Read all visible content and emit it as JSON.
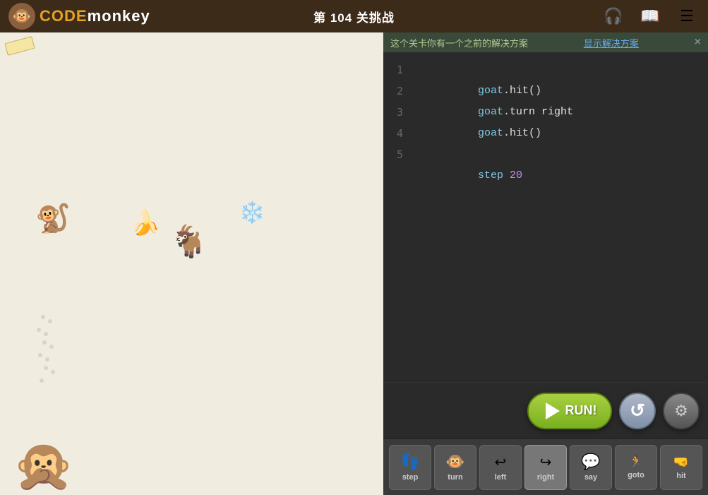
{
  "header": {
    "logo_monkey_emoji": "🐵",
    "logo_text_code": "CODE",
    "logo_text_monkey": "monkey",
    "title": "第 104 关挑战",
    "icon_headphones": "🎧",
    "icon_map": "📖",
    "icon_menu": "☰"
  },
  "notice": {
    "text": "这个关卡你有一个之前的解决方案",
    "link_text": "显示解决方案",
    "close": "×"
  },
  "code": {
    "lines": [
      {
        "num": "1",
        "content": "goat.hit()"
      },
      {
        "num": "2",
        "content": "goat.turn right"
      },
      {
        "num": "3",
        "content": "goat.hit()"
      },
      {
        "num": "4",
        "content": ""
      },
      {
        "num": "5",
        "content": "step 20"
      }
    ]
  },
  "buttons": {
    "run_label": "RUN!",
    "reset_icon": "↻",
    "settings_icon": "⚙"
  },
  "toolbar": {
    "items": [
      {
        "icon": "👣",
        "label": "step"
      },
      {
        "icon": "🐵",
        "label": "turn"
      },
      {
        "icon": "⬅",
        "label": "left"
      },
      {
        "icon": "➡",
        "label": "right"
      },
      {
        "icon": "💬",
        "label": "say"
      },
      {
        "icon": "🏃",
        "label": "goto"
      },
      {
        "icon": "🤜",
        "label": "hit"
      }
    ]
  }
}
